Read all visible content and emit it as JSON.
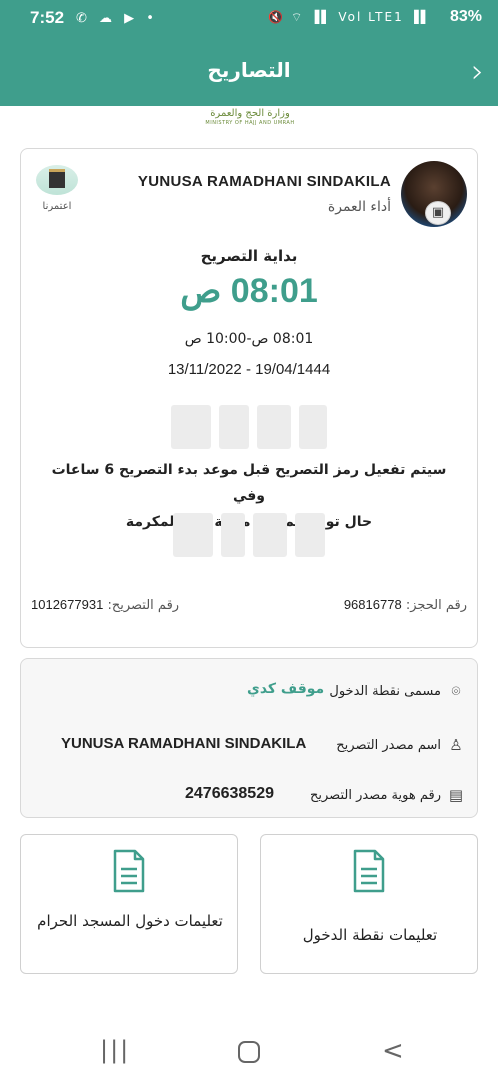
{
  "status_bar": {
    "time": "7:52",
    "left_icons": "✆ ☁ ▶ •",
    "right_icons": "🔇 ⌔ ▐▌ Vol LTE1 ▐▌",
    "battery": "83%"
  },
  "header": {
    "title": "التصاريح",
    "back_glyph": "›"
  },
  "ministry": {
    "name_ar": "وزارة الحج والعمرة",
    "name_en": "MINISTRY OF HAJJ AND UMRAH"
  },
  "permit": {
    "holder_name": "YUNUSA RAMADHANI SINDAKILA",
    "permit_type": "أداء العمرة",
    "app_name": "اعتمرنا",
    "start_label": "بداية التصريح",
    "start_time": "08:01 ص",
    "time_range": "08:01 ص-10:00 ص",
    "date_range": "13/11/2022 - 19/04/1444",
    "activation_line1": "سيتم تفعيل رمز التصريح قبل موعد بدء التصريح  6  ساعات وفي",
    "activation_line2": "حال تواجدكم في مدينة  مكة المكرمة",
    "booking_label": "رقم الحجز:",
    "booking_number": "96816778",
    "permit_label": "رقم التصريح:",
    "permit_number": "1012677931"
  },
  "entry": {
    "point_label": "مسمى نقطة الدخول",
    "point_value": "موقف كدي",
    "issuer_label": "اسم مصدر التصريح",
    "issuer_value": "YUNUSA RAMADHANI  SINDAKILA",
    "issuer_id_label": "رقم هوية مصدر التصريح",
    "issuer_id_value": "2476638529"
  },
  "tiles": {
    "left_label": "تعليمات دخول المسجد الحرام",
    "right_label": "تعليمات نقطة الدخول"
  },
  "colors": {
    "accent": "#3f9e8c"
  }
}
